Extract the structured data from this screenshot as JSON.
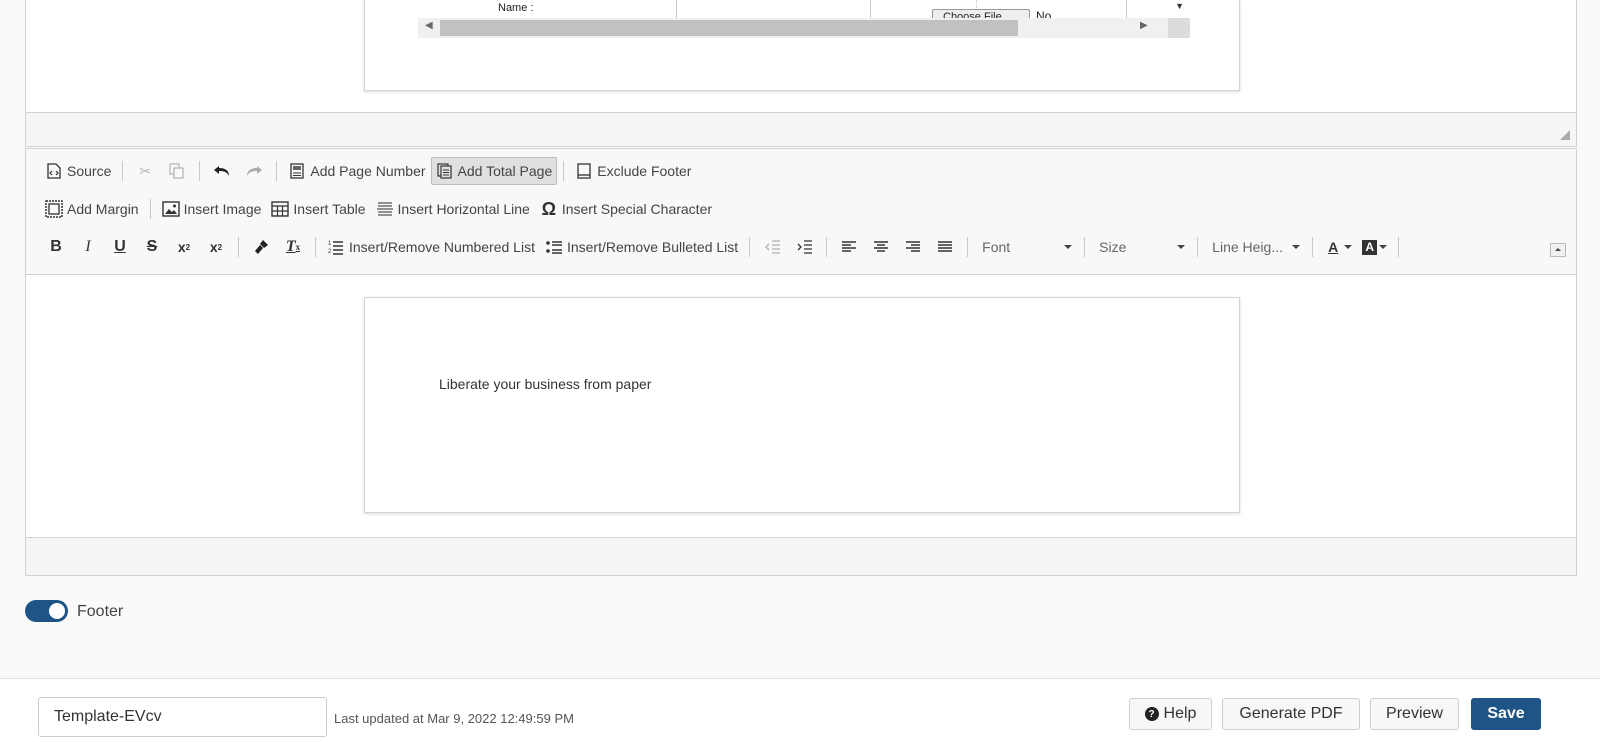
{
  "body_editor": {
    "table_label": "Name :",
    "choose_file_label": "Choose File",
    "no_file_text": "No"
  },
  "toolbar": {
    "source": "Source",
    "add_page_number": "Add Page Number",
    "add_total_page": "Add Total Page",
    "exclude_footer": "Exclude Footer",
    "add_margin": "Add Margin",
    "insert_image": "Insert Image",
    "insert_table": "Insert Table",
    "insert_horizontal_line": "Insert Horizontal Line",
    "insert_special_character": "Insert Special Character",
    "insert_numbered_list": "Insert/Remove Numbered List",
    "insert_bulleted_list": "Insert/Remove Bulleted List",
    "font_combo": "Font",
    "size_combo": "Size",
    "line_height_combo": "Line Heig..."
  },
  "footer_content": {
    "text": "Liberate your business from paper"
  },
  "footer_toggle": {
    "label": "Footer",
    "on": true
  },
  "action_bar": {
    "template_name": "Template-EVcv",
    "last_updated": "Last updated at Mar 9, 2022 12:49:59 PM",
    "help_label": "Help",
    "generate_pdf_label": "Generate PDF",
    "preview_label": "Preview",
    "save_label": "Save"
  },
  "colors": {
    "primary": "#1f5487",
    "toolbar_bg": "#f8f8f8",
    "border": "#d1d1d1"
  }
}
